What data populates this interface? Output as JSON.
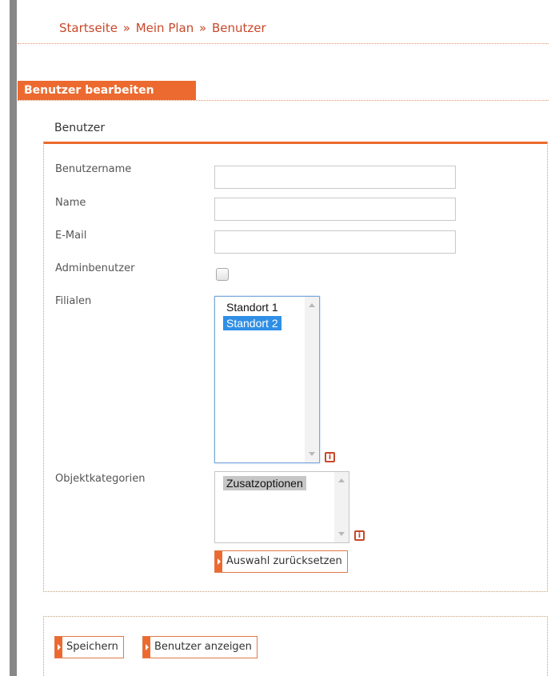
{
  "breadcrumb": {
    "items": [
      "Startseite",
      "Mein Plan",
      "Benutzer"
    ],
    "separator": "»"
  },
  "section": {
    "title": "Benutzer bearbeiten"
  },
  "form": {
    "legend": "Benutzer",
    "labels": {
      "username": "Benutzername",
      "name": "Name",
      "email": "E-Mail",
      "admin": "Adminbenutzer",
      "branches": "Filialen",
      "object_categories": "Objektkategorien"
    },
    "values": {
      "username": "",
      "name": "",
      "email": "",
      "admin": false
    },
    "branches": {
      "options": [
        "Standort 1",
        "Standort 2"
      ],
      "selected": "Standort 2"
    },
    "object_categories": {
      "options": [
        "Zusatzoptionen"
      ],
      "selected": "Zusatzoptionen"
    },
    "reset_button": "Auswahl zurücksetzen",
    "info_icon": "info-icon"
  },
  "footer": {
    "save_button": "Speichern",
    "show_users_button": "Benutzer anzeigen"
  },
  "colors": {
    "accent": "#ec6a2f",
    "link": "#c8482a",
    "selection": "#2f8fe6"
  }
}
